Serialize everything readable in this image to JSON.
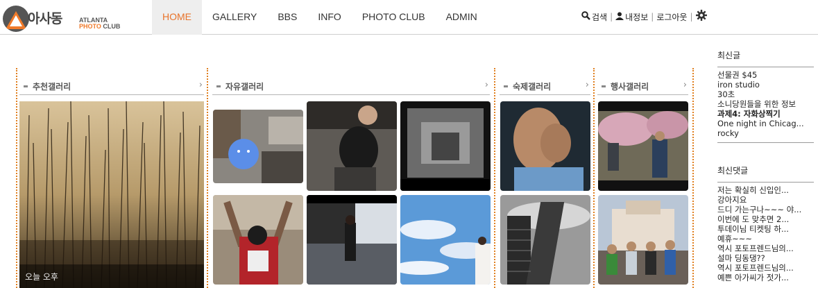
{
  "header": {
    "logo_kor": "아사동",
    "logo_en_line1": "ATLANTA",
    "logo_en_photo": "PHOTO",
    "logo_en_club": "CLUB",
    "nav": [
      {
        "label": "HOME",
        "active": true
      },
      {
        "label": "GALLERY",
        "active": false
      },
      {
        "label": "BBS",
        "active": false
      },
      {
        "label": "INFO",
        "active": false
      },
      {
        "label": "PHOTO CLUB",
        "active": false
      },
      {
        "label": "ADMIN",
        "active": false
      }
    ],
    "util": {
      "search_label": "검색",
      "myinfo_label": "내정보",
      "logout_label": "로그아웃"
    },
    "accent_color": "#e8732a"
  },
  "sections": {
    "recommend": {
      "title": "추천갤러리",
      "more": "›",
      "caption": "오늘 오후"
    },
    "free": {
      "title": "자유갤러리",
      "more": "›"
    },
    "homework": {
      "title": "숙제갤러리",
      "more": "›"
    },
    "event": {
      "title": "행사갤러리",
      "more": "›"
    }
  },
  "sidebar": {
    "recent_posts_title": "최신글",
    "recent_posts": [
      {
        "text": "선물권 $45",
        "bold": false
      },
      {
        "text": "iron studio",
        "bold": false
      },
      {
        "text": "30초",
        "bold": false
      },
      {
        "text": "소니당원들을 위한 정보",
        "bold": false
      },
      {
        "text": "과제4: 자화상찍기",
        "bold": true
      },
      {
        "text": "One night in Chicag...",
        "bold": false
      },
      {
        "text": "rocky",
        "bold": false
      }
    ],
    "recent_comments_title": "최신댓글",
    "recent_comments": [
      "저는 확실히 신입인...",
      "강아지요",
      "드디 가는구나~~~ 야...",
      "이번에 도 맞추면 2...",
      "투데이님 티켓팅 하...",
      "예휴~~~",
      "역시 포토프렌드님의...",
      "설마 딩동댕??",
      "역시 포토프렌드님의...",
      "예쁜 아가씨가 젓가..."
    ]
  }
}
